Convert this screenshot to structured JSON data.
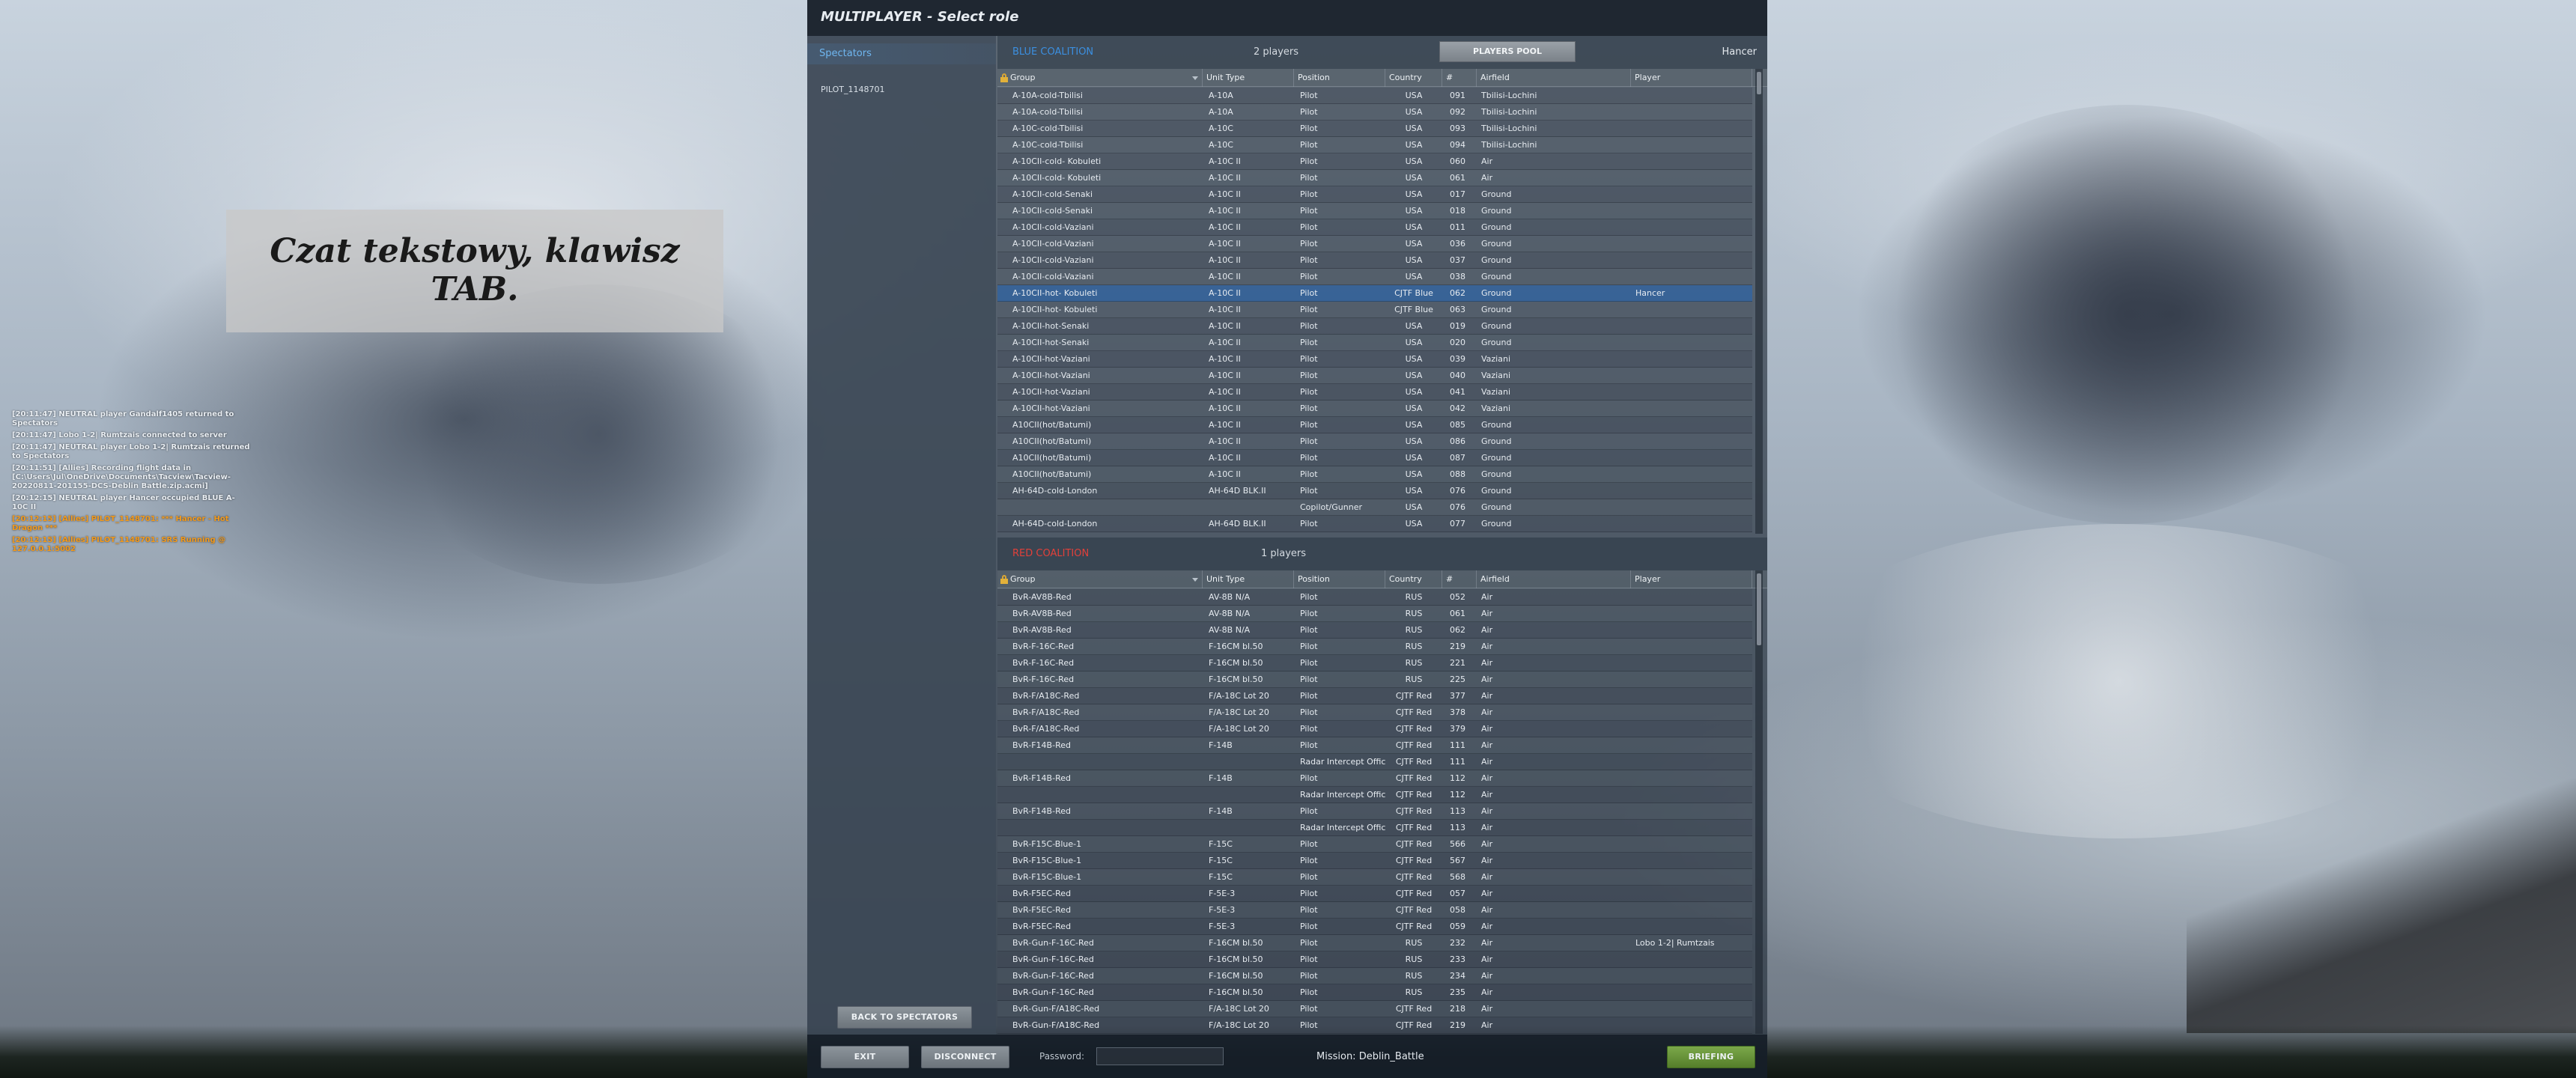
{
  "window": {
    "title": "MULTIPLAYER - Select role"
  },
  "hint": {
    "text": "Czat tekstowy, klawisz TAB."
  },
  "chat": [
    {
      "text": "[20:11:47] NEUTRAL player Gandalf1405 returned to Spectators",
      "color": "white"
    },
    {
      "text": "[20:11:47] Lobo 1-2| Rumtzais connected to server",
      "color": "white"
    },
    {
      "text": "[20:11:47] NEUTRAL player Lobo 1-2| Rumtzais returned to Spectators",
      "color": "white"
    },
    {
      "text": "[20:11:51] [Allies] Recording flight data in [C:\\Users\\Jul\\OneDrive\\Documents\\Tacview\\Tacview-20220811-201155-DCS-Deblin Battle.zip.acmi]",
      "color": "white"
    },
    {
      "text": "[20:12:15] NEUTRAL player Hancer occupied BLUE A-10C II",
      "color": "white"
    },
    {
      "text": "[20:12:15] [Allies] PILOT_1148701: *** Hancer - Hot Dragon ***",
      "color": "orange"
    },
    {
      "text": "[20:12:15] [Allies] PILOT_1148701: SRS Running @ 127.0.0.1:5002",
      "color": "orange"
    }
  ],
  "left_panel": {
    "spectators_label": "Spectators",
    "spectators": [
      "PILOT_1148701"
    ],
    "back_button": "BACK TO SPECTATORS"
  },
  "columns": {
    "group": "Group",
    "unit_type": "Unit Type",
    "position": "Position",
    "country": "Country",
    "num": "#",
    "airfield": "Airfield",
    "player": "Player"
  },
  "blue": {
    "name": "BLUE COALITION",
    "count": "2 players",
    "pool_button": "PLAYERS POOL",
    "pool_player": "Hancer",
    "rows": [
      [
        "A-10A-cold-Tbilisi",
        "A-10A",
        "Pilot",
        "USA",
        "091",
        "Tbilisi-Lochini",
        ""
      ],
      [
        "A-10A-cold-Tbilisi",
        "A-10A",
        "Pilot",
        "USA",
        "092",
        "Tbilisi-Lochini",
        ""
      ],
      [
        "A-10C-cold-Tbilisi",
        "A-10C",
        "Pilot",
        "USA",
        "093",
        "Tbilisi-Lochini",
        ""
      ],
      [
        "A-10C-cold-Tbilisi",
        "A-10C",
        "Pilot",
        "USA",
        "094",
        "Tbilisi-Lochini",
        ""
      ],
      [
        "A-10CII-cold- Kobuleti",
        "A-10C II",
        "Pilot",
        "USA",
        "060",
        "Air",
        ""
      ],
      [
        "A-10CII-cold- Kobuleti",
        "A-10C II",
        "Pilot",
        "USA",
        "061",
        "Air",
        ""
      ],
      [
        "A-10CII-cold-Senaki",
        "A-10C II",
        "Pilot",
        "USA",
        "017",
        "Ground",
        ""
      ],
      [
        "A-10CII-cold-Senaki",
        "A-10C II",
        "Pilot",
        "USA",
        "018",
        "Ground",
        ""
      ],
      [
        "A-10CII-cold-Vaziani",
        "A-10C II",
        "Pilot",
        "USA",
        "011",
        "Ground",
        ""
      ],
      [
        "A-10CII-cold-Vaziani",
        "A-10C II",
        "Pilot",
        "USA",
        "036",
        "Ground",
        ""
      ],
      [
        "A-10CII-cold-Vaziani",
        "A-10C II",
        "Pilot",
        "USA",
        "037",
        "Ground",
        ""
      ],
      [
        "A-10CII-cold-Vaziani",
        "A-10C II",
        "Pilot",
        "USA",
        "038",
        "Ground",
        ""
      ],
      [
        "A-10CII-hot- Kobuleti",
        "A-10C II",
        "Pilot",
        "CJTF Blue",
        "062",
        "Ground",
        "Hancer"
      ],
      [
        "A-10CII-hot- Kobuleti",
        "A-10C II",
        "Pilot",
        "CJTF Blue",
        "063",
        "Ground",
        ""
      ],
      [
        "A-10CII-hot-Senaki",
        "A-10C II",
        "Pilot",
        "USA",
        "019",
        "Ground",
        ""
      ],
      [
        "A-10CII-hot-Senaki",
        "A-10C II",
        "Pilot",
        "USA",
        "020",
        "Ground",
        ""
      ],
      [
        "A-10CII-hot-Vaziani",
        "A-10C II",
        "Pilot",
        "USA",
        "039",
        "Vaziani",
        ""
      ],
      [
        "A-10CII-hot-Vaziani",
        "A-10C II",
        "Pilot",
        "USA",
        "040",
        "Vaziani",
        ""
      ],
      [
        "A-10CII-hot-Vaziani",
        "A-10C II",
        "Pilot",
        "USA",
        "041",
        "Vaziani",
        ""
      ],
      [
        "A-10CII-hot-Vaziani",
        "A-10C II",
        "Pilot",
        "USA",
        "042",
        "Vaziani",
        ""
      ],
      [
        "A10CII(hot/Batumi)",
        "A-10C II",
        "Pilot",
        "USA",
        "085",
        "Ground",
        ""
      ],
      [
        "A10CII(hot/Batumi)",
        "A-10C II",
        "Pilot",
        "USA",
        "086",
        "Ground",
        ""
      ],
      [
        "A10CII(hot/Batumi)",
        "A-10C II",
        "Pilot",
        "USA",
        "087",
        "Ground",
        ""
      ],
      [
        "A10CII(hot/Batumi)",
        "A-10C II",
        "Pilot",
        "USA",
        "088",
        "Ground",
        ""
      ],
      [
        "AH-64D-cold-London",
        "AH-64D BLK.II",
        "Pilot",
        "USA",
        "076",
        "Ground",
        ""
      ],
      [
        "",
        "",
        "Copilot/Gunner",
        "USA",
        "076",
        "Ground",
        ""
      ],
      [
        "AH-64D-cold-London",
        "AH-64D BLK.II",
        "Pilot",
        "USA",
        "077",
        "Ground",
        ""
      ]
    ]
  },
  "red": {
    "name": "RED COALITION",
    "count": "1 players",
    "rows": [
      [
        "BvR-AV8B-Red",
        "AV-8B N/A",
        "Pilot",
        "RUS",
        "052",
        "Air",
        ""
      ],
      [
        "BvR-AV8B-Red",
        "AV-8B N/A",
        "Pilot",
        "RUS",
        "061",
        "Air",
        ""
      ],
      [
        "BvR-AV8B-Red",
        "AV-8B N/A",
        "Pilot",
        "RUS",
        "062",
        "Air",
        ""
      ],
      [
        "BvR-F-16C-Red",
        "F-16CM bl.50",
        "Pilot",
        "RUS",
        "219",
        "Air",
        ""
      ],
      [
        "BvR-F-16C-Red",
        "F-16CM bl.50",
        "Pilot",
        "RUS",
        "221",
        "Air",
        ""
      ],
      [
        "BvR-F-16C-Red",
        "F-16CM bl.50",
        "Pilot",
        "RUS",
        "225",
        "Air",
        ""
      ],
      [
        "BvR-F/A18C-Red",
        "F/A-18C Lot 20",
        "Pilot",
        "CJTF Red",
        "377",
        "Air",
        ""
      ],
      [
        "BvR-F/A18C-Red",
        "F/A-18C Lot 20",
        "Pilot",
        "CJTF Red",
        "378",
        "Air",
        ""
      ],
      [
        "BvR-F/A18C-Red",
        "F/A-18C Lot 20",
        "Pilot",
        "CJTF Red",
        "379",
        "Air",
        ""
      ],
      [
        "BvR-F14B-Red",
        "F-14B",
        "Pilot",
        "CJTF Red",
        "111",
        "Air",
        ""
      ],
      [
        "",
        "",
        "Radar Intercept Offic",
        "CJTF Red",
        "111",
        "Air",
        ""
      ],
      [
        "BvR-F14B-Red",
        "F-14B",
        "Pilot",
        "CJTF Red",
        "112",
        "Air",
        ""
      ],
      [
        "",
        "",
        "Radar Intercept Offic",
        "CJTF Red",
        "112",
        "Air",
        ""
      ],
      [
        "BvR-F14B-Red",
        "F-14B",
        "Pilot",
        "CJTF Red",
        "113",
        "Air",
        ""
      ],
      [
        "",
        "",
        "Radar Intercept Offic",
        "CJTF Red",
        "113",
        "Air",
        ""
      ],
      [
        "BvR-F15C-Blue-1",
        "F-15C",
        "Pilot",
        "CJTF Red",
        "566",
        "Air",
        ""
      ],
      [
        "BvR-F15C-Blue-1",
        "F-15C",
        "Pilot",
        "CJTF Red",
        "567",
        "Air",
        ""
      ],
      [
        "BvR-F15C-Blue-1",
        "F-15C",
        "Pilot",
        "CJTF Red",
        "568",
        "Air",
        ""
      ],
      [
        "BvR-F5EC-Red",
        "F-5E-3",
        "Pilot",
        "CJTF Red",
        "057",
        "Air",
        ""
      ],
      [
        "BvR-F5EC-Red",
        "F-5E-3",
        "Pilot",
        "CJTF Red",
        "058",
        "Air",
        ""
      ],
      [
        "BvR-F5EC-Red",
        "F-5E-3",
        "Pilot",
        "CJTF Red",
        "059",
        "Air",
        ""
      ],
      [
        "BvR-Gun-F-16C-Red",
        "F-16CM bl.50",
        "Pilot",
        "RUS",
        "232",
        "Air",
        "Lobo 1-2| Rumtzais"
      ],
      [
        "BvR-Gun-F-16C-Red",
        "F-16CM bl.50",
        "Pilot",
        "RUS",
        "233",
        "Air",
        ""
      ],
      [
        "BvR-Gun-F-16C-Red",
        "F-16CM bl.50",
        "Pilot",
        "RUS",
        "234",
        "Air",
        ""
      ],
      [
        "BvR-Gun-F-16C-Red",
        "F-16CM bl.50",
        "Pilot",
        "RUS",
        "235",
        "Air",
        ""
      ],
      [
        "BvR-Gun-F/A18C-Red",
        "F/A-18C Lot 20",
        "Pilot",
        "CJTF Red",
        "218",
        "Air",
        ""
      ],
      [
        "BvR-Gun-F/A18C-Red",
        "F/A-18C Lot 20",
        "Pilot",
        "CJTF Red",
        "219",
        "Air",
        ""
      ]
    ]
  },
  "bottom": {
    "exit": "EXIT",
    "disconnect": "DISCONNECT",
    "password_label": "Password:",
    "password_value": "",
    "mission": "Mission: Deblin_Battle",
    "briefing": "BRIEFING"
  },
  "colors": {
    "blue_coalition": "#3b8fe0",
    "red_coalition": "#e2403a",
    "selected_row": "#34649e",
    "briefing_button": "#6a9a3c",
    "chat_orange": "#f39a1c"
  }
}
